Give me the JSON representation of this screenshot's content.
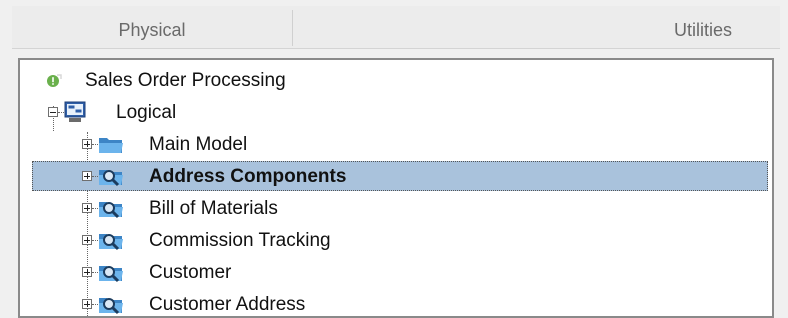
{
  "tabs": [
    {
      "label": "Physical"
    },
    {
      "label": "Utilities"
    }
  ],
  "tree": {
    "root": {
      "label": "Sales Order Processing",
      "icon": "green-status-icon"
    },
    "logical": {
      "label": "Logical",
      "icon": "logical-model-icon",
      "expanded": true
    },
    "items": [
      {
        "label": "Main Model",
        "icon": "folder-icon",
        "selected": false
      },
      {
        "label": "Address Components",
        "icon": "subject-area-icon",
        "selected": true
      },
      {
        "label": "Bill of Materials",
        "icon": "subject-area-icon",
        "selected": false
      },
      {
        "label": "Commission Tracking",
        "icon": "subject-area-icon",
        "selected": false
      },
      {
        "label": "Customer",
        "icon": "subject-area-icon",
        "selected": false
      },
      {
        "label": "Customer Address",
        "icon": "subject-area-icon",
        "selected": false
      }
    ]
  },
  "colors": {
    "selection": "#a9c2dc",
    "folder": "#5ba3de",
    "status": "#6ab04c"
  }
}
